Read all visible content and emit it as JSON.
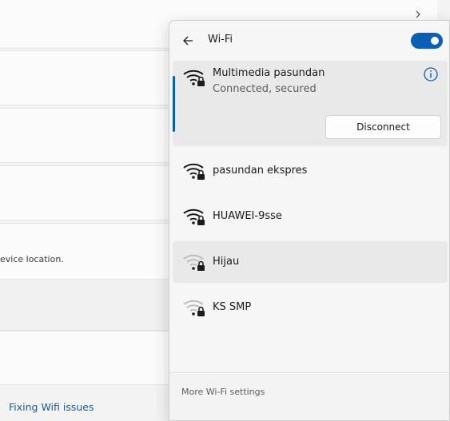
{
  "background": {
    "location_text": "evice location.",
    "fixing_link": "Fixing Wifi issues"
  },
  "flyout": {
    "title": "Wi-Fi",
    "toggle_on": true,
    "accent": "#0a5fb4",
    "networks": [
      {
        "name": "Multimedia pasundan",
        "status": "Connected, secured",
        "action": "Disconnect",
        "signal": "full",
        "secured": true
      },
      {
        "name": "pasundan ekspres",
        "signal": "full",
        "secured": true
      },
      {
        "name": "HUAWEI-9sse",
        "signal": "full",
        "secured": true
      },
      {
        "name": "Hijau",
        "signal": "weak",
        "secured": true
      },
      {
        "name": "KS SMP",
        "signal": "weak",
        "secured": true
      }
    ],
    "footer_link": "More Wi-Fi settings"
  }
}
